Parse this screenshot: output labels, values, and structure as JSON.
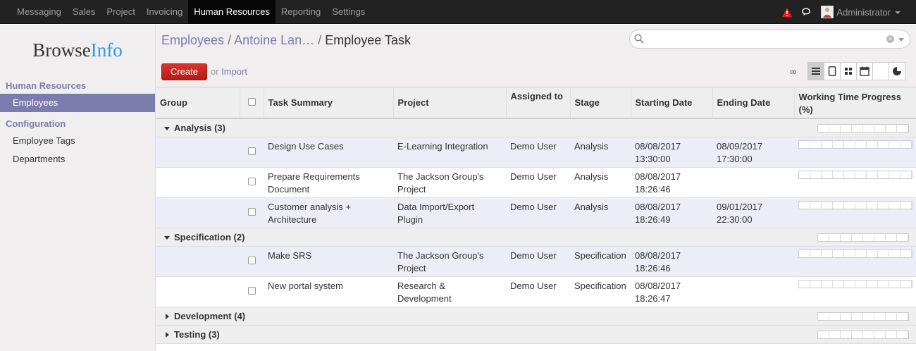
{
  "topbar": {
    "menu": [
      {
        "label": "Messaging",
        "active": false
      },
      {
        "label": "Sales",
        "active": false
      },
      {
        "label": "Project",
        "active": false
      },
      {
        "label": "Invoicing",
        "active": false
      },
      {
        "label": "Human Resources",
        "active": true
      },
      {
        "label": "Reporting",
        "active": false
      },
      {
        "label": "Settings",
        "active": false
      }
    ],
    "user_name": "Administrator"
  },
  "sidebar": {
    "logo_part1": "Browse",
    "logo_part2": "Info",
    "sections": [
      {
        "heading": "Human Resources",
        "items": [
          {
            "label": "Employees",
            "active": true
          }
        ]
      },
      {
        "heading": "Configuration",
        "items": [
          {
            "label": "Employee Tags",
            "active": false
          },
          {
            "label": "Departments",
            "active": false
          }
        ]
      }
    ]
  },
  "breadcrumb": {
    "first": "Employees",
    "second": "Antoine Lan…",
    "current": "Employee Task",
    "separator": "/"
  },
  "search": {
    "placeholder": ""
  },
  "toolbar": {
    "create_label": "Create",
    "or_label": "or",
    "import_label": "Import",
    "infinity": "∞"
  },
  "table": {
    "columns": [
      "Group",
      "",
      "Task Summary",
      "Project",
      "Assigned to",
      "Stage",
      "Starting Date",
      "Ending Date",
      "Working Time Progress (%)"
    ],
    "groups": [
      {
        "name": "Analysis (3)",
        "expanded": true,
        "rows": [
          {
            "task": "Design Use Cases",
            "project": "E-Learning Integration",
            "assigned": "Demo User",
            "stage": "Analysis",
            "start": "08/08/2017 13:30:00",
            "end": "08/09/2017 17:30:00",
            "progress": 0
          },
          {
            "task": "Prepare Requirements Document",
            "project": "The Jackson Group's Project",
            "assigned": "Demo User",
            "stage": "Analysis",
            "start": "08/08/2017 18:26:46",
            "end": "",
            "progress": 0
          },
          {
            "task": "Customer analysis + Architecture",
            "project": "Data Import/Export Plugin",
            "assigned": "Demo User",
            "stage": "Analysis",
            "start": "08/08/2017 18:26:49",
            "end": "09/01/2017 22:30:00",
            "progress": 0
          }
        ]
      },
      {
        "name": "Specification (2)",
        "expanded": true,
        "rows": [
          {
            "task": "Make SRS",
            "project": "The Jackson Group's Project",
            "assigned": "Demo User",
            "stage": "Specification",
            "start": "08/08/2017 18:26:46",
            "end": "",
            "progress": 0
          },
          {
            "task": "New portal system",
            "project": "Research & Development",
            "assigned": "Demo User",
            "stage": "Specification",
            "start": "08/08/2017 18:26:47",
            "end": "",
            "progress": 0
          }
        ]
      },
      {
        "name": "Development (4)",
        "expanded": false,
        "rows": []
      },
      {
        "name": "Testing (3)",
        "expanded": false,
        "rows": []
      }
    ]
  },
  "colors": {
    "accent": "#7c7bad",
    "create": "#c9201a",
    "topbar": "#222222"
  }
}
